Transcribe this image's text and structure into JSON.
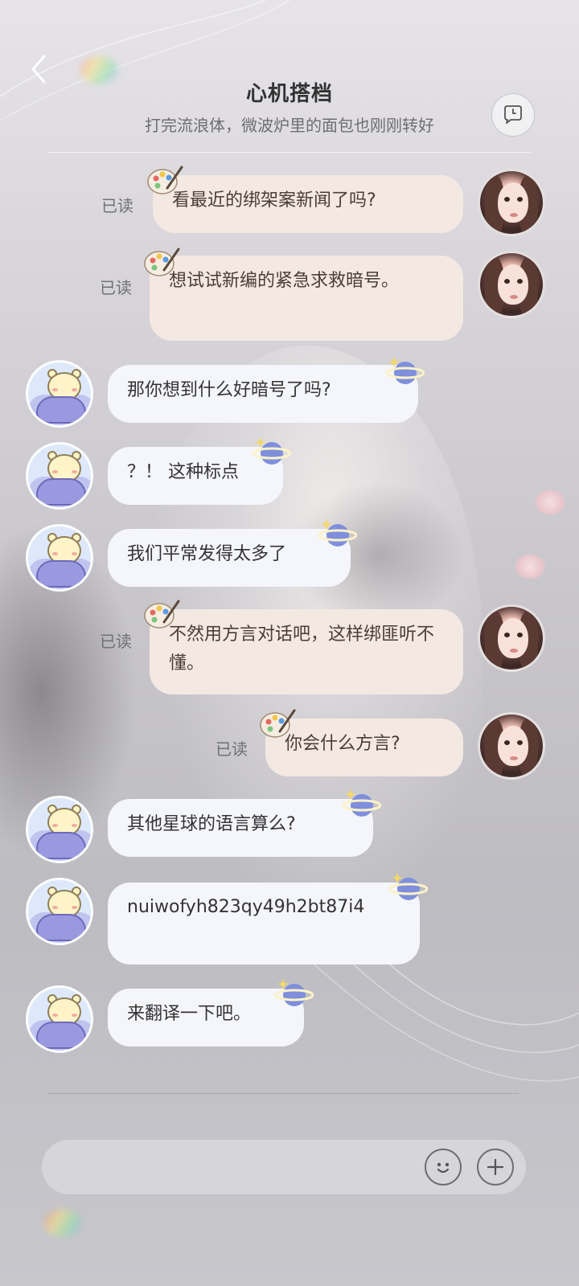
{
  "header": {
    "title": "心机搭档",
    "subtitle": "打完流浪体，微波炉里的面包也刚刚转好"
  },
  "icons": {
    "back": "chevron-left-icon",
    "header_action": "chat-bubble-clock-icon",
    "emoji": "smiley-face-icon",
    "add": "plus-icon",
    "me_sticker": "palette-icon",
    "other_sticker": "planet-icon"
  },
  "messages": [
    {
      "sender": "me",
      "text": "看最近的绑架案新闻了吗?",
      "status": "已读"
    },
    {
      "sender": "me",
      "text": "想试试新编的紧急求救暗号。",
      "status": "已读"
    },
    {
      "sender": "other",
      "text": "那你想到什么好暗号了吗?"
    },
    {
      "sender": "other",
      "text": "？！ 这种标点"
    },
    {
      "sender": "other",
      "text": "我们平常发得太多了"
    },
    {
      "sender": "me",
      "text": "不然用方言对话吧，这样绑匪听不懂。",
      "status": "已读"
    },
    {
      "sender": "me",
      "text": "你会什么方言?",
      "status": "已读"
    },
    {
      "sender": "other",
      "text": "其他星球的语言算么?"
    },
    {
      "sender": "other",
      "text": "nuiwofyh823qy49h2bt87i4"
    },
    {
      "sender": "other",
      "text": "来翻译一下吧。"
    }
  ],
  "input": {
    "placeholder": "",
    "value": ""
  },
  "colors": {
    "me_bubble": "#f4e9e2",
    "other_bubble": "#f5f6fb",
    "title": "#333333",
    "subtitle": "#6e6e72"
  }
}
